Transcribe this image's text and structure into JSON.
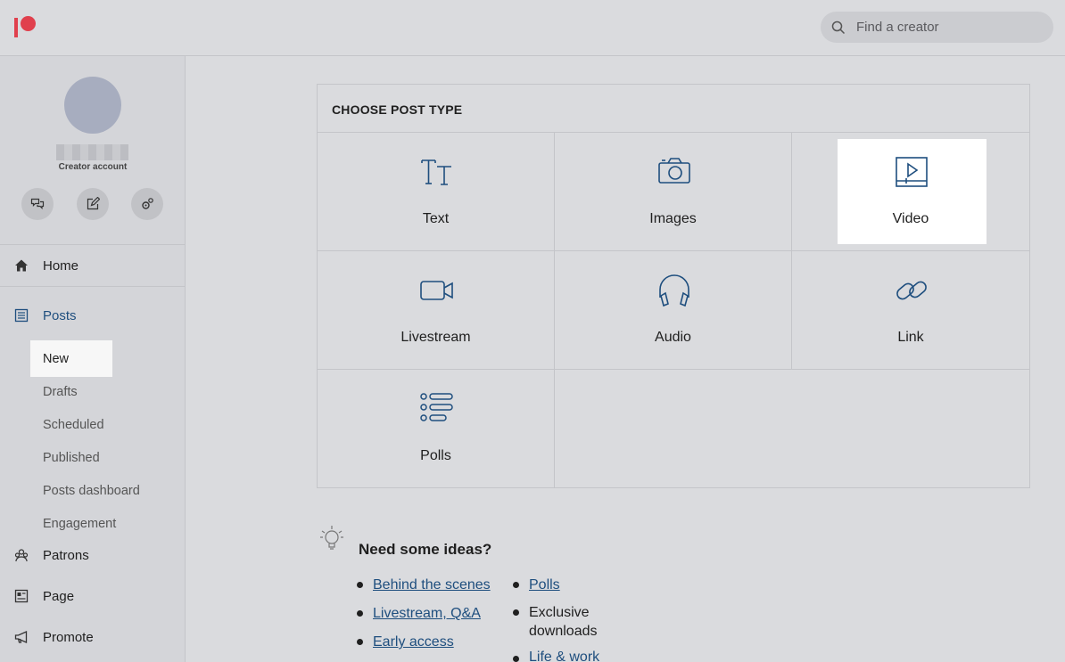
{
  "app": {
    "brand": "Patreon"
  },
  "search": {
    "placeholder": "Find a creator"
  },
  "profile": {
    "account_type": "Creator account"
  },
  "sidebar": {
    "home": "Home",
    "posts": "Posts",
    "posts_sub": [
      "New",
      "Drafts",
      "Scheduled",
      "Published",
      "Posts dashboard",
      "Engagement"
    ],
    "patrons": "Patrons",
    "page": "Page",
    "promote": "Promote"
  },
  "main": {
    "title": "CHOOSE POST TYPE",
    "post_types": [
      "Text",
      "Images",
      "Video",
      "Livestream",
      "Audio",
      "Link",
      "Polls"
    ],
    "highlighted": "Video"
  },
  "ideas": {
    "title": "Need some ideas?",
    "items": [
      "Behind the scenes",
      "Livestream, Q&A",
      "Early access",
      "Polls",
      "Exclusive downloads",
      "Life & work"
    ]
  },
  "colors": {
    "brand": "#e0404d",
    "accent": "#1e4e7e",
    "background": "#dadbde"
  }
}
